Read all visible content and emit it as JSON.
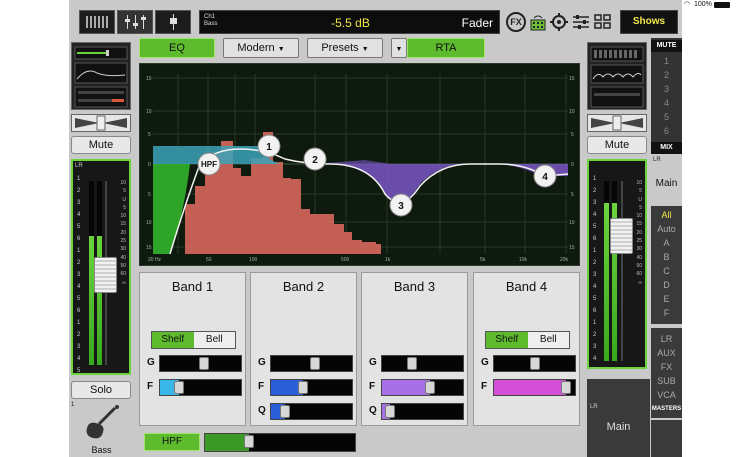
{
  "topbar": {
    "channel_num": "Ch1",
    "channel_name": "Bass",
    "value": "-5.5 dB",
    "mode": "Fader",
    "fx_label": "FX",
    "shows_label": "Shows"
  },
  "left": {
    "mute_label": "Mute",
    "solo_label": "Solo",
    "lr_label": "LR",
    "channel_number": "1",
    "channel_name": "Bass",
    "meter_level": 0.7,
    "fader_level": 0.55
  },
  "toolbar": {
    "eq_label": "EQ",
    "eq_type": "Modern",
    "presets_label": "Presets",
    "rta_label": "RTA"
  },
  "graph": {
    "y_ticks": [
      "15",
      "10",
      "5",
      "0",
      "5",
      "10",
      "15"
    ],
    "x_ticks": [
      "20 Hz",
      "50",
      "100",
      "500",
      "1k",
      "5k",
      "10k",
      "20k"
    ],
    "nodes": [
      "HPF",
      "1",
      "2",
      "3",
      "4"
    ]
  },
  "bands": [
    {
      "title": "Band 1",
      "shelf": "Shelf",
      "bell": "Bell",
      "mode": "Shelf",
      "g_label": "G",
      "f_label": "F",
      "q_label": "",
      "gain": 0.55,
      "freq": 0.2,
      "q": null,
      "color": "#39b7e8"
    },
    {
      "title": "Band 2",
      "shelf": "",
      "bell": "",
      "mode": "",
      "g_label": "G",
      "f_label": "F",
      "q_label": "Q",
      "gain": 0.55,
      "freq": 0.38,
      "q": 0.12,
      "color": "#2a5fd8"
    },
    {
      "title": "Band 3",
      "shelf": "",
      "bell": "",
      "mode": "",
      "g_label": "G",
      "f_label": "F",
      "q_label": "Q",
      "gain": 0.35,
      "freq": 0.6,
      "q": 0.04,
      "color": "#a770e6"
    },
    {
      "title": "Band 4",
      "shelf": "Shelf",
      "bell": "Bell",
      "mode": "Shelf",
      "g_label": "G",
      "f_label": "F",
      "q_label": "",
      "gain": 0.5,
      "freq": 0.95,
      "q": null,
      "color": "#d34fd6"
    }
  ],
  "hpf": {
    "label": "HPF",
    "value": 0.5
  },
  "right": {
    "mute_header": "MUTE",
    "mute_groups": [
      "1",
      "2",
      "3",
      "4",
      "5",
      "6"
    ],
    "mix_header": "MIX",
    "mix_lr": "LR",
    "mix_main": "Main",
    "filters": [
      "All",
      "Auto",
      "A",
      "B",
      "C",
      "D",
      "E",
      "F"
    ],
    "sections": [
      "LR",
      "AUX",
      "FX",
      "SUB",
      "VCA"
    ],
    "masters_label": "MASTERS",
    "strip_lr": "LR",
    "strip_main": "Main",
    "mute_label": "Mute",
    "meter_level": 0.88,
    "fader_level": 0.78
  },
  "colors": {
    "accent_green": "#5dbb2d",
    "value_yellow": "#f2e84a",
    "rta_red": "#d8675e",
    "band1_teal": "#39a3b8",
    "band3_purple": "#7a57c6"
  }
}
